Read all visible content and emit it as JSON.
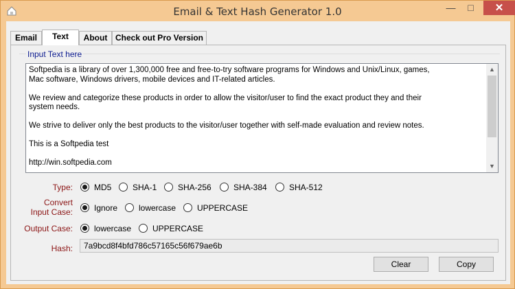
{
  "window": {
    "title": "Email & Text Hash Generator 1.0",
    "min_glyph": "—",
    "max_glyph": "□",
    "close_glyph": "✕"
  },
  "tabs": [
    {
      "label": "Email"
    },
    {
      "label": "Text"
    },
    {
      "label": "About"
    },
    {
      "label": "Check out Pro Version"
    }
  ],
  "input": {
    "group_label": "Input Text here",
    "text": "Softpedia is a library of over 1,300,000 free and free-to-try software programs for Windows and Unix/Linux, games,\nMac software, Windows drivers, mobile devices and IT-related articles.\n\nWe review and categorize these products in order to allow the visitor/user to find the exact product they and their\nsystem needs.\n\nWe strive to deliver only the best products to the visitor/user together with self-made evaluation and review notes.\n\nThis is a Softpedia test\n\nhttp://win.softpedia.com"
  },
  "type_row": {
    "label": "Type:",
    "options": [
      "MD5",
      "SHA-1",
      "SHA-256",
      "SHA-384",
      "SHA-512"
    ],
    "selected": "MD5"
  },
  "convert_row": {
    "label_line1": "Convert",
    "label_line2": "Input Case:",
    "options": [
      "Ignore",
      "lowercase",
      "UPPERCASE"
    ],
    "selected": "Ignore"
  },
  "output_row": {
    "label": "Output Case:",
    "options": [
      "lowercase",
      "UPPERCASE"
    ],
    "selected": "lowercase"
  },
  "hash": {
    "label": "Hash:",
    "value": "7a9bcd8f4bfd786c57165c56f679ae6b"
  },
  "buttons": {
    "clear": "Clear",
    "copy": "Copy"
  },
  "colors": {
    "titlebar": "#f5c993",
    "close_button": "#c7504a",
    "group_label": "#0b1a8f",
    "row_label": "#8b1414"
  }
}
